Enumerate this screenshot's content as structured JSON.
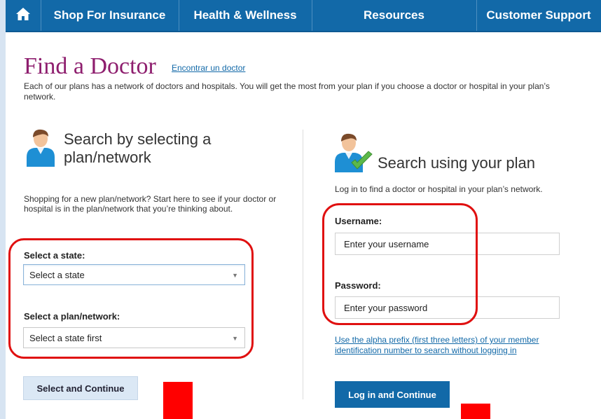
{
  "nav": {
    "home_icon": "home-icon",
    "items": [
      {
        "label": "Shop For Insurance"
      },
      {
        "label": "Health & Wellness"
      },
      {
        "label": "Resources"
      },
      {
        "label": "Customer Support"
      }
    ]
  },
  "page": {
    "title": "Find a Doctor",
    "spanish_link": "Encontrar un doctor",
    "intro": "Each of our plans has a network of doctors and hospitals. You will get the most from your plan if you choose a doctor or hospital in your plan’s network."
  },
  "left": {
    "icon": "person-icon",
    "heading": "Search by selecting a plan/network",
    "description": "Shopping for a new plan/network? Start here to see if your doctor or hospital is in the plan/network that you’re thinking about.",
    "state_label": "Select a state:",
    "state_value": "Select a state",
    "plan_label": "Select a plan/network:",
    "plan_value": "Select a state first",
    "button": "Select and Continue"
  },
  "right": {
    "icon": "person-check-icon",
    "heading": "Search using your plan",
    "description": "Log in to find a doctor or hospital in your plan’s network.",
    "username_label": "Username:",
    "username_placeholder": "Enter your username",
    "password_label": "Password:",
    "password_placeholder": "Enter your password",
    "alpha_link": "Use the alpha prefix (first three letters) of your member identification number to search without logging in",
    "button": "Log in and Continue"
  },
  "colors": {
    "nav": "#1269a8",
    "title": "#8e1e6e",
    "annotation": "#e01010"
  }
}
